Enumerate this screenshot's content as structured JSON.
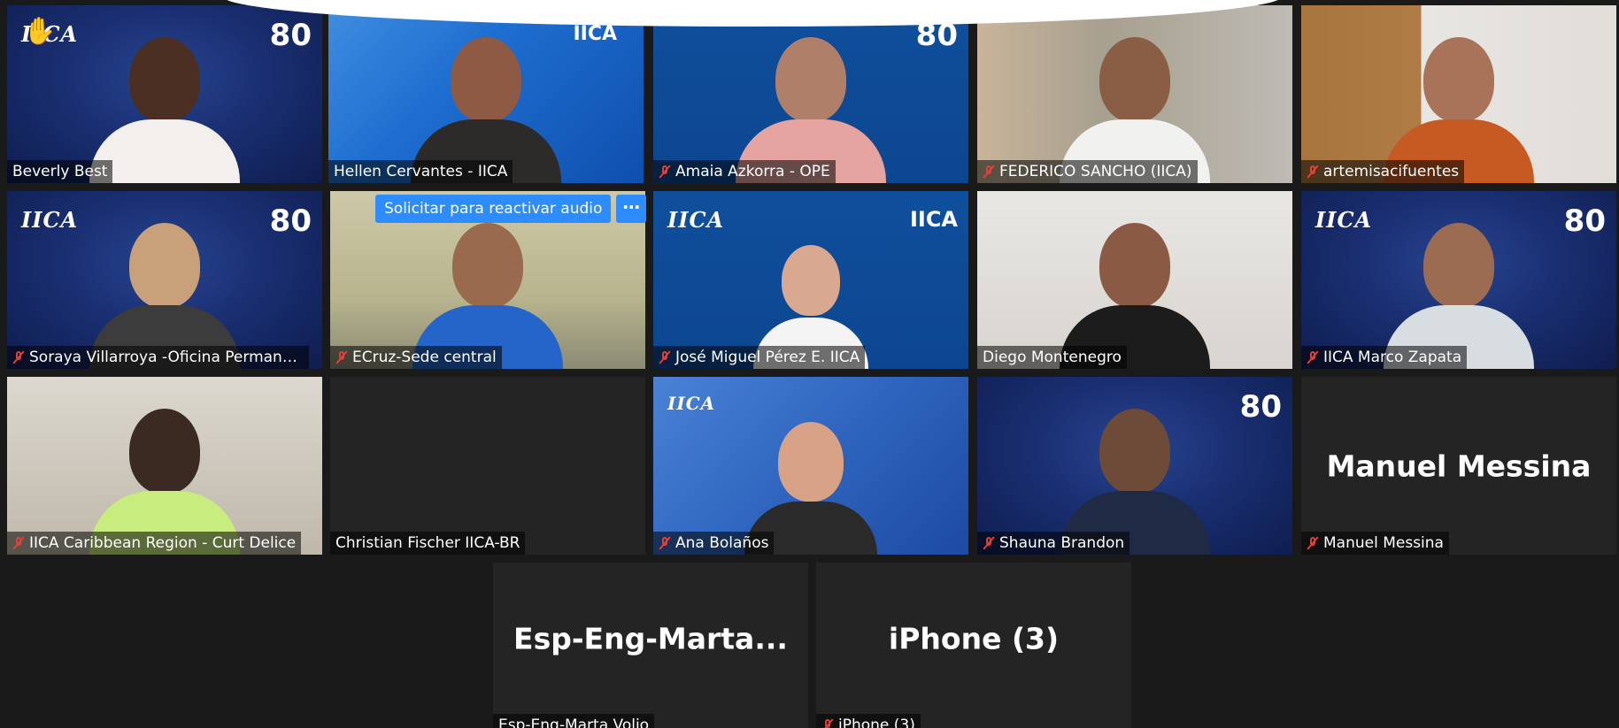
{
  "unmute_request": {
    "label": "Solicitar para reactivar audio",
    "more_label": "⋯"
  },
  "brand": {
    "logo_text": "IICA",
    "badge_text": "80"
  },
  "participants": [
    {
      "name": "Beverly Best",
      "muted": false,
      "hand_raised": true
    },
    {
      "name": "Hellen Cervantes - IICA",
      "muted": false,
      "active_speaker": true
    },
    {
      "name": "Amaia Azkorra - OPE",
      "muted": true
    },
    {
      "name": "FEDERICO SANCHO (IICA)",
      "muted": true
    },
    {
      "name": "artemisacifuentes",
      "muted": true
    },
    {
      "name": "Soraya Villarroya -Oficina Permanente para Europa",
      "muted": true
    },
    {
      "name": "ECruz-Sede central",
      "muted": true
    },
    {
      "name": "José Miguel Pérez E. IICA",
      "muted": true
    },
    {
      "name": "Diego Montenegro",
      "muted": false
    },
    {
      "name": "IICA Marco Zapata",
      "muted": true
    },
    {
      "name": "IICA Caribbean Region - Curt Delice",
      "muted": true
    },
    {
      "name": "Christian Fischer IICA-BR",
      "muted": false
    },
    {
      "name": "Ana Bolaños",
      "muted": true
    },
    {
      "name": "Shauna Brandon",
      "muted": true
    },
    {
      "name": "Manuel Messina",
      "display_name": "Manuel Messina",
      "muted": true
    },
    {
      "name": "Esp-Eng-Marta Volio",
      "display_name": "Esp-Eng-Marta...",
      "muted": false
    },
    {
      "name": "iPhone (3)",
      "display_name": "iPhone (3)",
      "muted": true
    }
  ],
  "colors": {
    "background": "#1a1a1a",
    "tile": "#242424",
    "active_speaker_border": "#e8f07a",
    "muted_icon": "#e0403a",
    "unmute_button": "#2d8cff"
  }
}
